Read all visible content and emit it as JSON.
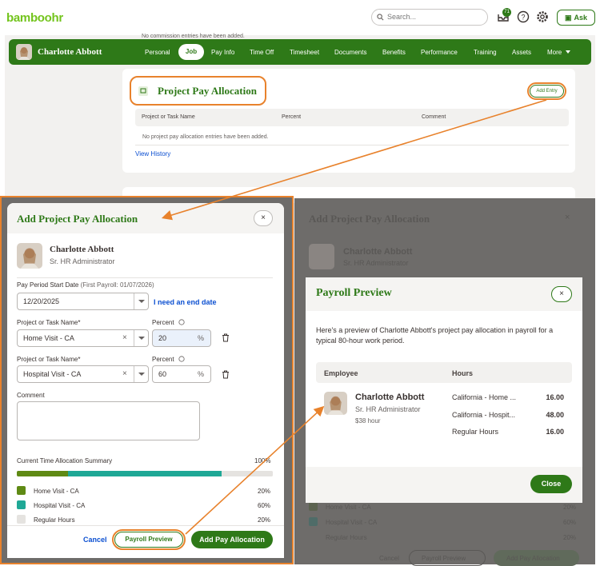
{
  "header": {
    "logo": "bamboohr",
    "search_placeholder": "Search...",
    "badge": "71",
    "ask": "Ask"
  },
  "bg": {
    "commission_note": "No commission entries have been added."
  },
  "nav": {
    "employee_name": "Charlotte Abbott",
    "items": [
      "Personal",
      "Job",
      "Pay Info",
      "Time Off",
      "Timesheet",
      "Documents",
      "Benefits",
      "Performance",
      "Training",
      "Assets",
      "More"
    ]
  },
  "section": {
    "title": "Project Pay Allocation",
    "add_entry": "Add Entry",
    "columns": [
      "Project or Task Name",
      "Percent",
      "Comment"
    ],
    "empty": "No project pay allocation entries have been added.",
    "view_history": "View History"
  },
  "modal": {
    "title": "Add Project Pay Allocation",
    "close": "×",
    "name": "Charlotte Abbott",
    "role": "Sr. HR Administrator",
    "pay_period_label": "Pay Period Start Date",
    "pay_period_sub": "(First Payroll: 01/07/2026)",
    "date": "12/20/2025",
    "end_date_link": "I need an end date",
    "rows": [
      {
        "project_label": "Project or Task Name*",
        "project": "Home Visit - CA",
        "percent_label": "Percent",
        "percent": "20",
        "unit": "%"
      },
      {
        "project_label": "Project or Task Name*",
        "project": "Hospital Visit - CA",
        "percent_label": "Percent",
        "percent": "60",
        "unit": "%"
      }
    ],
    "comment_label": "Comment",
    "summary_label": "Current Time Allocation Summary",
    "summary_total": "100%",
    "legend": [
      {
        "label": "Home Visit - CA",
        "value": "20%",
        "fraction": 0.2,
        "color": "#5f8a14"
      },
      {
        "label": "Hospital Visit - CA",
        "value": "60%",
        "fraction": 0.6,
        "color": "#1fa896"
      },
      {
        "label": "Regular Hours",
        "value": "20%",
        "fraction": 0.2,
        "color": "#e5e3e0"
      }
    ],
    "cancel": "Cancel",
    "payroll_preview": "Payroll Preview",
    "add": "Add Pay Allocation"
  },
  "ghost": {
    "title": "Add Project Pay Allocation",
    "name": "Charlotte Abbott",
    "role": "Sr. HR Administrator",
    "leg1": "Home Visit - CA",
    "leg2": "Hospital Visit - CA",
    "leg3": "Regular Hours",
    "v1": "20%",
    "v2": "60%",
    "v3": "20%",
    "cancel": "Cancel",
    "preview": "Payroll Preview",
    "add": "Add Pay Allocation"
  },
  "preview": {
    "title": "Payroll Preview",
    "close": "×",
    "description": "Here's a preview of Charlotte Abbott's project pay allocation in payroll for a typical 80-hour work period.",
    "col_employee": "Employee",
    "col_hours": "Hours",
    "name": "Charlotte Abbott",
    "role": "Sr. HR Administrator",
    "rate": "$38 hour",
    "rows": [
      {
        "label": "California - Home ...",
        "hours": "16.00"
      },
      {
        "label": "California - Hospit...",
        "hours": "48.00"
      },
      {
        "label": "Regular Hours",
        "hours": "16.00"
      }
    ],
    "close_btn": "Close"
  }
}
